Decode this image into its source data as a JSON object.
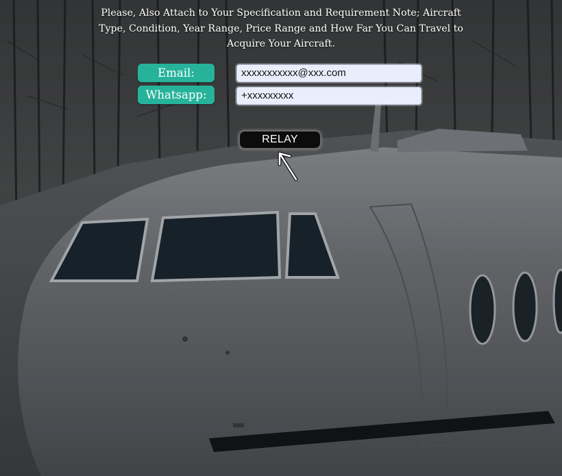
{
  "note": {
    "text": "Please, Also Attach to Your Specification and Requirement Note;   Aircraft Type, Condition, Year Range, Price Range and How Far You Can Travel to Acquire Your Aircraft."
  },
  "form": {
    "email_label": "Email:",
    "email_value": "xxxxxxxxxxx@xxx.com",
    "whatsapp_label": "Whatsapp:",
    "whatsapp_value": "+xxxxxxxxx",
    "submit_label": "RELAY"
  },
  "colors": {
    "label_bg": "#27b39b",
    "field_bg": "#e9eefc",
    "button_bg": "#0c0c0c"
  },
  "icons": {
    "cursor": "arrow-cursor-icon"
  }
}
